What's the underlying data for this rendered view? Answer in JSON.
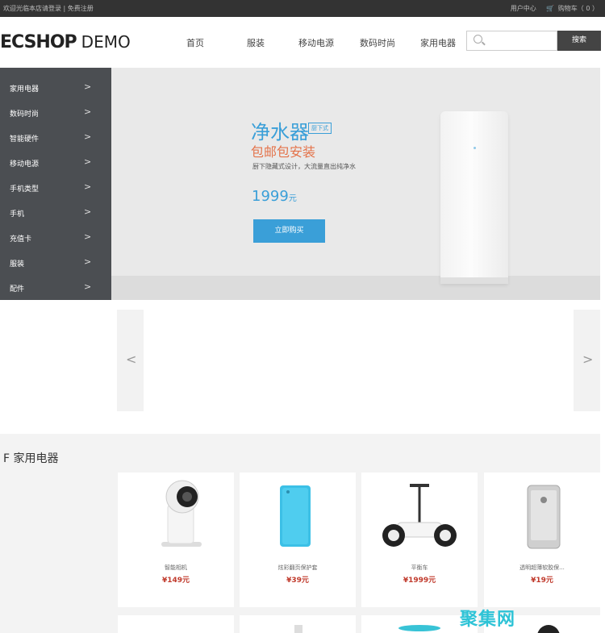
{
  "topbar": {
    "welcome": "欢迎光临本店请登录",
    "register": "免费注册",
    "user_center": "用户中心",
    "cart": "购物车（ 0 ）"
  },
  "logo": {
    "brand": "ECSHOP",
    "suffix": "DEMO"
  },
  "nav": [
    "首页",
    "服装",
    "移动电源",
    "数码时尚",
    "家用电器"
  ],
  "search": {
    "placeholder": "",
    "button": "搜索"
  },
  "sidebar": {
    "items": [
      {
        "label": "家用电器"
      },
      {
        "label": "数码时尚"
      },
      {
        "label": "智能硬件"
      },
      {
        "label": "移动电源"
      },
      {
        "label": "手机类型"
      },
      {
        "label": "手机"
      },
      {
        "label": "充值卡"
      },
      {
        "label": "服装"
      },
      {
        "label": "配件"
      }
    ]
  },
  "hero": {
    "title": "净水器",
    "badge": "厨下式",
    "subtitle": "包邮包安装",
    "desc": "厨下隐藏式设计，大流量直出纯净水",
    "price": "1999",
    "price_unit": "元",
    "buy_button": "立即购买",
    "slide_count": 3,
    "active_slide": 2
  },
  "floor": {
    "title": "F 家用电器",
    "products": [
      {
        "name": "智能相机",
        "price": "¥149元"
      },
      {
        "name": "炫彩翻页保护套",
        "price": "¥39元"
      },
      {
        "name": "平衡车",
        "price": "¥1999元"
      },
      {
        "name": "透明超薄软胶保...",
        "price": "¥19元"
      }
    ]
  },
  "watermark": "聚集网",
  "colors": {
    "accent": "#3a9fd8",
    "price": "#c0392b",
    "sidebar": "#4b4e52",
    "topbar": "#333333"
  }
}
